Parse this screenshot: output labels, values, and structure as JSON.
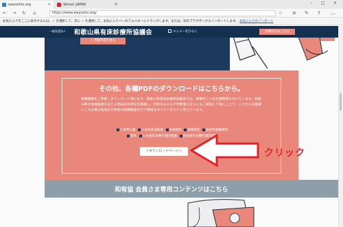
{
  "browser": {
    "tabs": [
      {
        "label": "wayoshio.org",
        "active": true,
        "favicon_color": "#2a7fd4"
      },
      {
        "label": "Yahoo! JAPAN",
        "active": false,
        "favicon_color": "#e0232a"
      }
    ],
    "new_tab_symbol": "+",
    "tab_close_symbol": "×",
    "window_controls": [
      "–",
      "□",
      "×"
    ],
    "nav": {
      "back": "←",
      "forward": "→",
      "refresh": "↻",
      "home": "⌂"
    },
    "url": "https://www.wayosho.org/",
    "toolbar_icons": {
      "star": "☆",
      "reading": "≡",
      "pen": "✎",
      "share": "⇪",
      "more": "…"
    },
    "favorites_bar": {
      "text": "お気に入りをここに表示するには、☆ を選択して、次に ☆ を選択して、お気に入りバーのフォルダーにドラッグします。または、別のブラウザーからインポートします。",
      "link": "お気に入りのインポート"
    }
  },
  "site": {
    "header": {
      "logo_small": "一般社団法人",
      "logo": "和歌山県有床診療所協議会",
      "menu_label": "メニューをひらく",
      "member_button": "会員の方はこちら"
    },
    "detail_button": "> 活動内容を見る",
    "download_section": {
      "title": "その他、各種PDFのダウンロードはこちらから。",
      "body": "各種書類をご参照・ダウンロード頂けます。和歌山県有床診療所協議会では、新規のご入会を随時受け付けています。和歌山県の地域医療を支える有床診の存在を教護し、行政のみならず利用者の方々にもご認知して頂くことで、これからの医療にこそ必要な有床診の存続や新規開設を行う環境を作っていきたいと考えています。",
      "categories": [
        "入会申込書",
        "入会決定通知書",
        "会員規定",
        "会費規定",
        "役員等推薦規定",
        "定款",
        "入会員年会費引落同意書",
        "新会員年会費引落同意書"
      ],
      "button": ">ダウンロードページへ"
    },
    "members_section": {
      "title": "和有協 会員さま専用コンテンツはこちら"
    }
  },
  "annotation": {
    "label": "クリック",
    "color": "#e0232a"
  },
  "colors": {
    "navy": "#14304f",
    "salmon": "#e8877a",
    "gray_blue": "#8e9fab"
  }
}
